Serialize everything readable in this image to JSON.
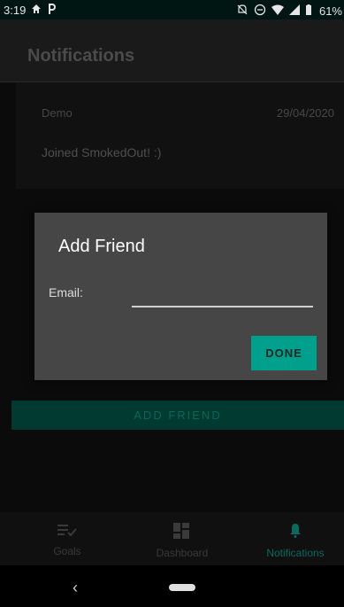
{
  "status_bar": {
    "time": "3:19",
    "battery_percent": "61%",
    "icons": [
      "home-icon",
      "parking-icon",
      "notifications-off-icon",
      "do-not-disturb-icon",
      "wifi-icon",
      "signal-icon",
      "battery-icon"
    ]
  },
  "app_bar": {
    "title": "Notifications"
  },
  "notification": {
    "name": "Demo",
    "date": "29/04/2020",
    "message": "Joined SmokedOut! :)"
  },
  "add_friend_bar": {
    "label": "ADD FRIEND"
  },
  "dialog": {
    "title": "Add Friend",
    "email_label": "Email:",
    "email_value": "",
    "done_label": "DONE"
  },
  "bottom_nav": {
    "items": [
      {
        "label": "Goals",
        "icon": "goals-icon"
      },
      {
        "label": "Dashboard",
        "icon": "dashboard-icon"
      },
      {
        "label": "Notifications",
        "icon": "bell-icon",
        "active": true
      }
    ]
  },
  "colors": {
    "accent": "#00a08c",
    "dialog_bg": "#464646"
  }
}
